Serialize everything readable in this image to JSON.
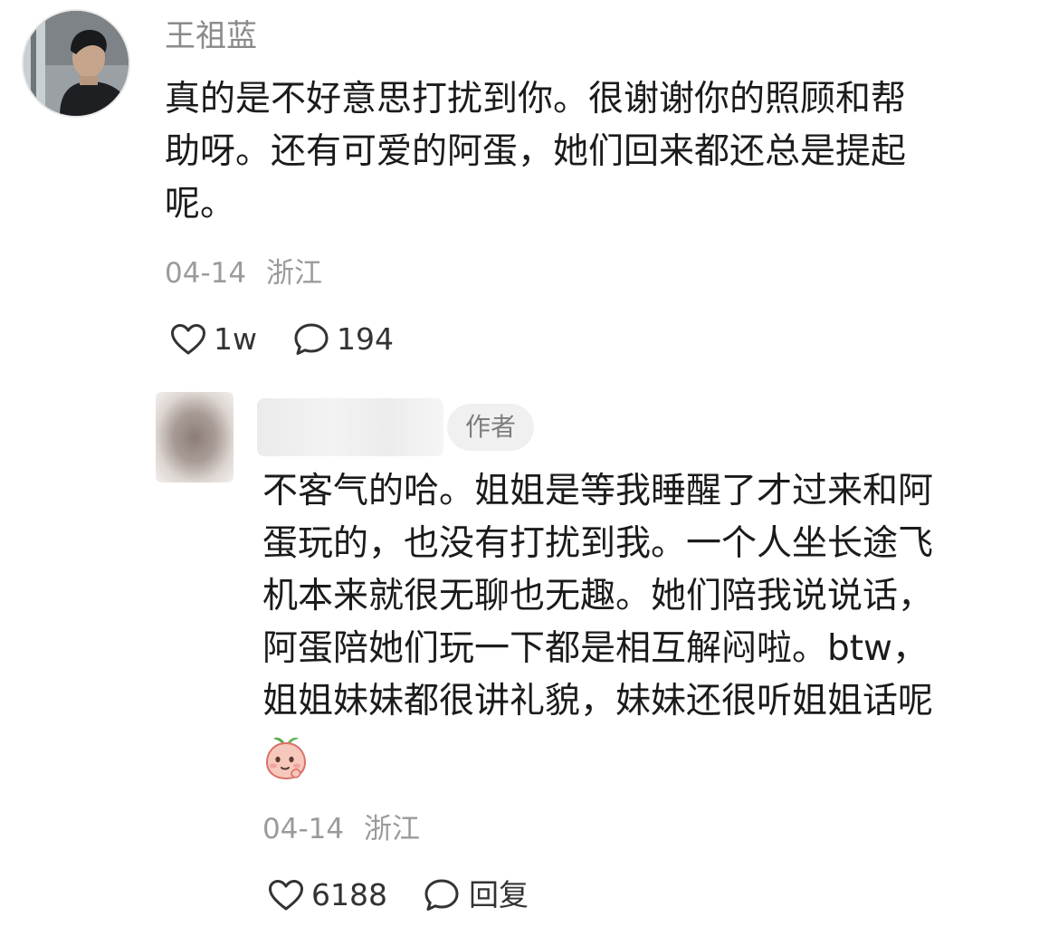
{
  "comment": {
    "author": "王祖蓝",
    "avatar": "person-photo-avatar",
    "lines": [
      "真的是不好意思打扰到你。很谢谢你的照顾和帮",
      "助呀。还有可爱的阿蛋，她们回来都还总是提起",
      "呢。"
    ],
    "date": "04-14",
    "location": "浙江",
    "likes": "1w",
    "replies_count": "194"
  },
  "reply": {
    "author_badge": "作者",
    "avatar": "blurred-avatar",
    "lines": [
      "不客气的哈。姐姐是等我睡醒了才过来和阿",
      "蛋玩的，也没有打扰到我。一个人坐长途飞",
      "机本来就很无聊也无趣。她们陪我说说话，",
      "阿蛋陪她们玩一下都是相互解闷啦。btw，",
      "姐姐妹妹都很讲礼貌，妹妹还很听姐姐话呢"
    ],
    "emoji": "peach-face-emoji",
    "date": "04-14",
    "location": "浙江",
    "likes": "6188",
    "reply_label": "回复"
  },
  "colors": {
    "text": "#1b1b1b",
    "meta": "#9b9b9b",
    "name": "#8a8a8a",
    "badge_bg": "#f0f0f0"
  }
}
